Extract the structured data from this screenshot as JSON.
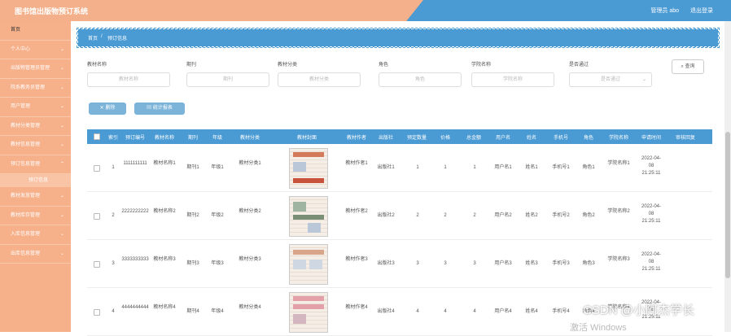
{
  "app": {
    "title": "图书馆出版物预订系统"
  },
  "topbar": {
    "admin_label": "管理员 abo",
    "exit_label": "退出登录"
  },
  "sidebar": {
    "items": [
      {
        "label": "首页",
        "chevron": false
      },
      {
        "label": "个人中心",
        "chevron": true
      },
      {
        "label": "出版物管理员管理",
        "chevron": true
      },
      {
        "label": "院系教务员管理",
        "chevron": true
      },
      {
        "label": "用户管理",
        "chevron": true
      },
      {
        "label": "教材分类管理",
        "chevron": true
      },
      {
        "label": "教材信息管理",
        "chevron": true
      },
      {
        "label": "预订信息管理",
        "chevron": true
      },
      {
        "label": "教材发放管理",
        "chevron": true
      },
      {
        "label": "教材库存管理",
        "chevron": true
      },
      {
        "label": "入库信息管理",
        "chevron": true
      },
      {
        "label": "出库信息管理",
        "chevron": true
      }
    ],
    "sub_item": "预订信息"
  },
  "breadcrumb": {
    "home": "首页",
    "sep": "/",
    "current": "预订信息"
  },
  "search": {
    "fields": [
      {
        "label": "教材名称",
        "placeholder": "教材名称"
      },
      {
        "label": "期刊",
        "placeholder": "期刊"
      },
      {
        "label": "教材分类",
        "placeholder": "教材分类"
      },
      {
        "label": "角色",
        "placeholder": "角色"
      },
      {
        "label": "学院名称",
        "placeholder": "学院名称"
      },
      {
        "label": "是否通过",
        "placeholder": "是否通过"
      }
    ],
    "button": "查询"
  },
  "actions": {
    "delete": "删除",
    "report": "统计报表"
  },
  "table": {
    "headers": [
      "索引",
      "预订编号",
      "教材名称",
      "期刊",
      "年级",
      "教材分类",
      "教材封面",
      "教材作者",
      "出版社",
      "预定数量",
      "价格",
      "总金额",
      "用户名",
      "姓名",
      "手机号",
      "角色",
      "学院名称",
      "申请时间",
      "审核回复"
    ],
    "rows": [
      {
        "idx": "1",
        "code": "1111111111",
        "name": "教材名称1",
        "journal": "期刊1",
        "grade": "年级1",
        "category": "教材分类1",
        "author": "教材作者1",
        "publisher": "出版社1",
        "qty": "1",
        "price": "1",
        "total": "1",
        "user": "用户名1",
        "realname": "姓名1",
        "phone": "手机号1",
        "role": "角色1",
        "college": "学院名称1",
        "time": "2022-04-08 21:25:11"
      },
      {
        "idx": "2",
        "code": "2222222222",
        "name": "教材名称2",
        "journal": "期刊2",
        "grade": "年级2",
        "category": "教材分类2",
        "author": "教材作者2",
        "publisher": "出版社2",
        "qty": "2",
        "price": "2",
        "total": "2",
        "user": "用户名2",
        "realname": "姓名2",
        "phone": "手机号2",
        "role": "角色2",
        "college": "学院名称2",
        "time": "2022-04-08 21:25:11"
      },
      {
        "idx": "3",
        "code": "3333333333",
        "name": "教材名称3",
        "journal": "期刊3",
        "grade": "年级3",
        "category": "教材分类3",
        "author": "教材作者3",
        "publisher": "出版社3",
        "qty": "3",
        "price": "3",
        "total": "3",
        "user": "用户名3",
        "realname": "姓名3",
        "phone": "手机号3",
        "role": "角色3",
        "college": "学院名称3",
        "time": "2022-04-08 21:25:11"
      },
      {
        "idx": "4",
        "code": "4444444444",
        "name": "教材名称4",
        "journal": "期刊4",
        "grade": "年级4",
        "category": "教材分类4",
        "author": "教材作者4",
        "publisher": "出版社4",
        "qty": "4",
        "price": "4",
        "total": "4",
        "user": "用户名4",
        "realname": "姓名4",
        "phone": "手机号4",
        "role": "角色4",
        "college": "学院名称4",
        "time": "2022-04-08 21:25:11"
      }
    ]
  },
  "watermark": {
    "text": "CSDN @小阿杰学长",
    "sub": "激活 Windows"
  },
  "colors": {
    "accent": "#4a9ad4",
    "sidebar": "#f6b08a"
  }
}
